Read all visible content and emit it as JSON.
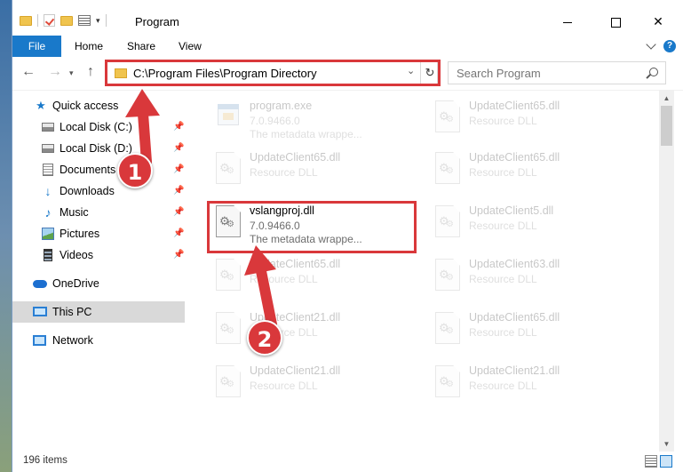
{
  "window": {
    "title": "Program",
    "minimize": "",
    "maximize": "",
    "close": "✕"
  },
  "ribbon": {
    "tabs": [
      "File",
      "Home",
      "Share",
      "View"
    ]
  },
  "address_bar": {
    "path": "C:\\Program Files\\Program Directory",
    "refresh_icon": "refresh-icon"
  },
  "search": {
    "placeholder": "Search Program"
  },
  "sidebar": {
    "items": [
      {
        "label": "Quick access",
        "icon": "star-icon"
      },
      {
        "label": "Local Disk (C:)",
        "icon": "disk-icon",
        "pinned": true
      },
      {
        "label": "Local Disk (D:)",
        "icon": "disk-icon",
        "pinned": true
      },
      {
        "label": "Documents",
        "icon": "documents-icon",
        "pinned": true
      },
      {
        "label": "Downloads",
        "icon": "downloads-icon",
        "pinned": true
      },
      {
        "label": "Music",
        "icon": "music-icon",
        "pinned": true
      },
      {
        "label": "Pictures",
        "icon": "pictures-icon",
        "pinned": true
      },
      {
        "label": "Videos",
        "icon": "videos-icon",
        "pinned": true
      },
      {
        "label": "OneDrive",
        "icon": "onedrive-icon"
      },
      {
        "label": "This PC",
        "icon": "this-pc-icon",
        "selected": true
      },
      {
        "label": "Network",
        "icon": "network-icon"
      }
    ]
  },
  "files": [
    {
      "name": "program.exe",
      "line2": "7.0.9466.0",
      "line3": "The metadata wrappe...",
      "type": "exe",
      "faded": true
    },
    {
      "name": "UpdateClient65.dll",
      "line2": "Resource DLL",
      "type": "dll",
      "faded": true
    },
    {
      "name": "UpdateClient65.dll",
      "line2": "Resource DLL",
      "type": "dll",
      "faded": true
    },
    {
      "name": "UpdateClient65.dll",
      "line2": "Resource DLL",
      "type": "dll",
      "faded": true
    },
    {
      "name": "vslangproj.dll",
      "line2": "7.0.9466.0",
      "line3": "The metadata wrappe...",
      "type": "dll",
      "faded": false
    },
    {
      "name": "UpdateClient5.dll",
      "line2": "Resource DLL",
      "type": "dll",
      "faded": true
    },
    {
      "name": "UpdateClient65.dll",
      "line2": "Resource DLL",
      "type": "dll",
      "faded": true
    },
    {
      "name": "UpdateClient63.dll",
      "line2": "Resource DLL",
      "type": "dll",
      "faded": true
    },
    {
      "name": "UpdateClient21.dll",
      "line2": "Resource DLL",
      "type": "dll",
      "faded": true
    },
    {
      "name": "UpdateClient65.dll",
      "line2": "Resource DLL",
      "type": "dll",
      "faded": true
    },
    {
      "name": "UpdateClient21.dll",
      "line2": "Resource DLL",
      "type": "dll",
      "faded": true
    },
    {
      "name": "UpdateClient21.dll",
      "line2": "Resource DLL",
      "type": "dll",
      "faded": true
    }
  ],
  "status_bar": {
    "item_count": "196 items"
  },
  "callouts": [
    "1",
    "2"
  ],
  "colors": {
    "accent": "#1979ca",
    "highlight": "#d9383b",
    "selection": "#d9d9d9"
  }
}
